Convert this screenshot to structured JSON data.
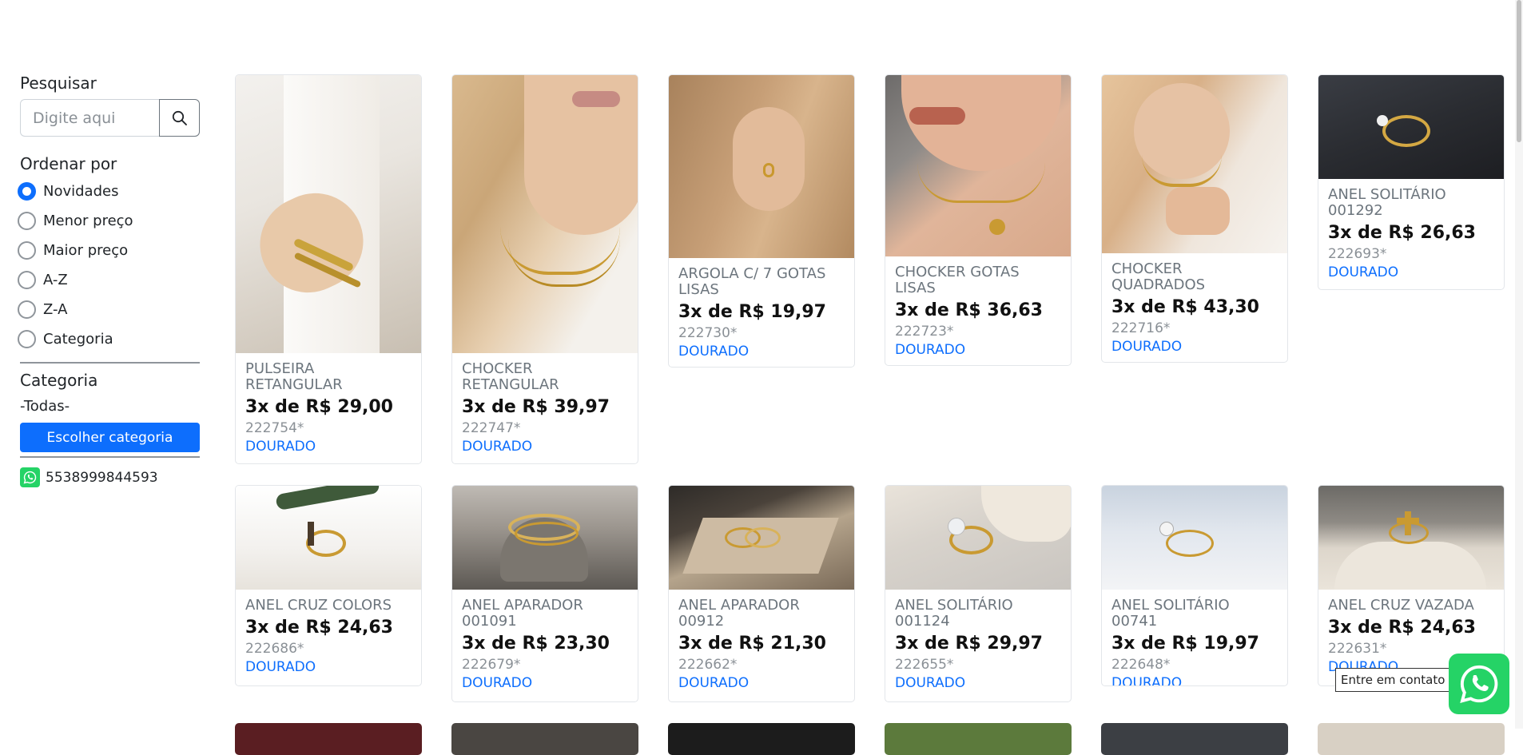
{
  "search": {
    "label": "Pesquisar",
    "placeholder": "Digite aqui"
  },
  "order": {
    "label": "Ordenar por",
    "options": [
      "Novidades",
      "Menor preço",
      "Maior preço",
      "A-Z",
      "Z-A",
      "Categoria"
    ],
    "selected": "Novidades"
  },
  "category": {
    "label": "Categoria",
    "value": "-Todas-",
    "button": "Escolher categoria"
  },
  "contact": {
    "phone": "5538999844593",
    "tooltip": "Entre em contato"
  },
  "products": [
    {
      "name": "PULSEIRA RETANGULAR",
      "price": "3x de R$ 29,00",
      "code": "222754*",
      "variant": "DOURADO"
    },
    {
      "name": "CHOCKER RETANGULAR",
      "price": "3x de R$ 39,97",
      "code": "222747*",
      "variant": "DOURADO"
    },
    {
      "name": "ARGOLA C/ 7 GOTAS LISAS",
      "price": "3x de R$ 19,97",
      "code": "222730*",
      "variant": "DOURADO"
    },
    {
      "name": "CHOCKER GOTAS LISAS",
      "price": "3x de R$ 36,63",
      "code": "222723*",
      "variant": "DOURADO"
    },
    {
      "name": "CHOCKER QUADRADOS",
      "price": "3x de R$ 43,30",
      "code": "222716*",
      "variant": "DOURADO"
    },
    {
      "name": "ANEL SOLITÁRIO 001292",
      "price": "3x de R$ 26,63",
      "code": "222693*",
      "variant": "DOURADO"
    },
    {
      "name": "ANEL CRUZ COLORS",
      "price": "3x de R$ 24,63",
      "code": "222686*",
      "variant": "DOURADO"
    },
    {
      "name": "ANEL APARADOR 001091",
      "price": "3x de R$ 23,30",
      "code": "222679*",
      "variant": "DOURADO"
    },
    {
      "name": "ANEL APARADOR 00912",
      "price": "3x de R$ 21,30",
      "code": "222662*",
      "variant": "DOURADO"
    },
    {
      "name": "ANEL SOLITÁRIO 001124",
      "price": "3x de R$ 29,97",
      "code": "222655*",
      "variant": "DOURADO"
    },
    {
      "name": "ANEL SOLITÁRIO 00741",
      "price": "3x de R$ 19,97",
      "code": "222648*",
      "variant": "DOURADO"
    },
    {
      "name": "ANEL CRUZ VAZADA",
      "price": "3x de R$ 24,63",
      "code": "222631*",
      "variant": "DOURADO"
    }
  ]
}
